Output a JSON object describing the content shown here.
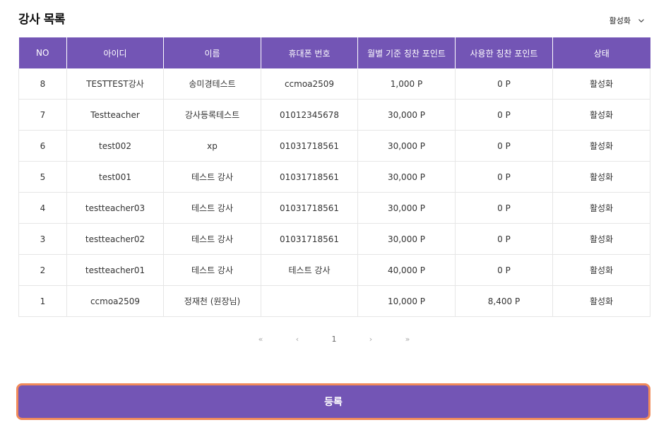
{
  "header": {
    "title": "강사 목록",
    "status_filter": "활성화",
    "status_filter_icon": "chevron-down-icon"
  },
  "table": {
    "columns": [
      "NO",
      "아이디",
      "이름",
      "휴대폰 번호",
      "월별 기준 칭찬 포인트",
      "사용한 칭찬 포인트",
      "상태"
    ],
    "rows": [
      {
        "no": "8",
        "id": "TESTTEST강사",
        "name": "송미경테스트",
        "phone": "ccmoa2509",
        "monthly_points": "1,000 P",
        "used_points": "0 P",
        "status": "활성화"
      },
      {
        "no": "7",
        "id": "Testteacher",
        "name": "강사등록테스트",
        "phone": "01012345678",
        "monthly_points": "30,000 P",
        "used_points": "0 P",
        "status": "활성화"
      },
      {
        "no": "6",
        "id": "test002",
        "name": "xp",
        "phone": "01031718561",
        "monthly_points": "30,000 P",
        "used_points": "0 P",
        "status": "활성화"
      },
      {
        "no": "5",
        "id": "test001",
        "name": "테스트 강사",
        "phone": "01031718561",
        "monthly_points": "30,000 P",
        "used_points": "0 P",
        "status": "활성화"
      },
      {
        "no": "4",
        "id": "testteacher03",
        "name": "테스트 강사",
        "phone": "01031718561",
        "monthly_points": "30,000 P",
        "used_points": "0 P",
        "status": "활성화"
      },
      {
        "no": "3",
        "id": "testteacher02",
        "name": "테스트 강사",
        "phone": "01031718561",
        "monthly_points": "30,000 P",
        "used_points": "0 P",
        "status": "활성화"
      },
      {
        "no": "2",
        "id": "testteacher01",
        "name": "테스트 강사",
        "phone": "테스트 강사",
        "monthly_points": "40,000 P",
        "used_points": "0 P",
        "status": "활성화"
      },
      {
        "no": "1",
        "id": "ccmoa2509",
        "name": "정재천 (원장님)",
        "phone": "",
        "monthly_points": "10,000 P",
        "used_points": "8,400 P",
        "status": "활성화"
      }
    ]
  },
  "pagination": {
    "first": "«",
    "prev": "‹",
    "current": "1",
    "next": "›",
    "last": "»"
  },
  "actions": {
    "register_label": "등록"
  },
  "colors": {
    "accent": "#7355b5",
    "button_border": "#f08a5a"
  }
}
